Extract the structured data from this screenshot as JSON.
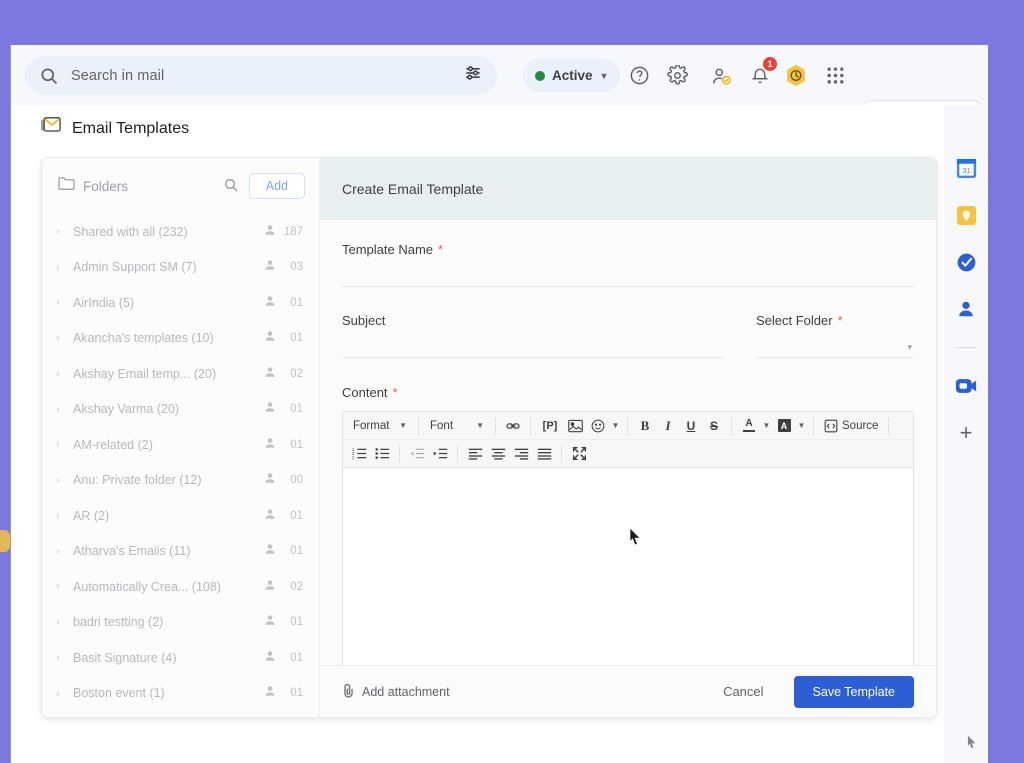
{
  "theme": {
    "purple_bg": "#7b78de",
    "accent_blue": "#2c5fd3",
    "header_bg": "#f6f8fc",
    "form_header_bg": "#e7eff0",
    "hiver_yellow": "#f5c344",
    "required_red": "#e06055",
    "status_green": "#1e8e3e",
    "badge_red": "#ea4335"
  },
  "topbar": {
    "search": {
      "icon": "search-icon",
      "placeholder": "Search in mail",
      "value": "",
      "options_icon": "search-options-icon"
    },
    "status": {
      "label": "Active",
      "dot_color": "#1e8e3e",
      "caret": "⌄"
    },
    "icons": [
      {
        "name": "help-icon",
        "glyph": "?"
      },
      {
        "name": "settings-gear-icon",
        "glyph": "gear"
      },
      {
        "name": "contacts-icon",
        "glyph": "person-check"
      },
      {
        "name": "notifications-bell-icon",
        "glyph": "bell",
        "badge": "1"
      },
      {
        "name": "hiver-clock-icon",
        "glyph": "hexagon-clock"
      },
      {
        "name": "google-apps-icon",
        "glyph": "grid"
      }
    ],
    "brand": {
      "name": "hiver",
      "logo": "hiver-hexagon-logo",
      "avatar": "user-avatar"
    }
  },
  "page": {
    "title": "Email Templates",
    "title_icon": "email-templates-icon"
  },
  "folders": {
    "header_label": "Folders",
    "header_icon": "folder-outline-icon",
    "search_icon": "folders-search-icon",
    "add_label": "Add",
    "items": [
      {
        "name": "Shared with all (232)",
        "users": "187"
      },
      {
        "name": "Admin Support SM (7)",
        "users": "03"
      },
      {
        "name": "AirIndia (5)",
        "users": "01"
      },
      {
        "name": "Akancha's templates (10)",
        "users": "01"
      },
      {
        "name": "Akshay Email temp... (20)",
        "users": "02"
      },
      {
        "name": "Akshay Varma (20)",
        "users": "01"
      },
      {
        "name": "AM-related (2)",
        "users": "01"
      },
      {
        "name": "Anu: Private folder (12)",
        "users": "00"
      },
      {
        "name": "AR (2)",
        "users": "01"
      },
      {
        "name": "Atharva's Emails (11)",
        "users": "01"
      },
      {
        "name": "Automatically Crea... (108)",
        "users": "02"
      },
      {
        "name": "badri testting (2)",
        "users": "01"
      },
      {
        "name": "Basit Signature (4)",
        "users": "01"
      },
      {
        "name": "Boston event (1)",
        "users": "01"
      }
    ]
  },
  "form": {
    "header": "Create Email Template",
    "template_name": {
      "label": "Template Name",
      "required": "*",
      "value": "",
      "placeholder": ""
    },
    "subject": {
      "label": "Subject",
      "required": "",
      "value": "",
      "placeholder": ""
    },
    "select_folder": {
      "label": "Select Folder",
      "required": "*",
      "value": "",
      "caret": "▾"
    },
    "content": {
      "label": "Content",
      "required": "*",
      "value": ""
    },
    "footer": {
      "add_attachment": "Add attachment",
      "attachment_icon": "paperclip-icon",
      "cancel": "Cancel",
      "save": "Save Template"
    }
  },
  "editor_toolbar": {
    "row1": [
      {
        "name": "format-dropdown",
        "label": "Format",
        "type": "combo"
      },
      {
        "name": "font-dropdown",
        "label": "Font",
        "type": "combo"
      },
      {
        "name": "insert-link-icon",
        "label": "",
        "type": "icon"
      },
      {
        "name": "placeholder-icon",
        "label": "[P]",
        "type": "icon"
      },
      {
        "name": "insert-image-icon",
        "label": "",
        "type": "icon"
      },
      {
        "name": "emoji-icon",
        "label": "",
        "type": "icon"
      },
      {
        "name": "bold-icon",
        "label": "B",
        "type": "icon"
      },
      {
        "name": "italic-icon",
        "label": "I",
        "type": "icon"
      },
      {
        "name": "underline-icon",
        "label": "U",
        "type": "icon"
      },
      {
        "name": "strikethrough-icon",
        "label": "S",
        "type": "icon"
      },
      {
        "name": "text-color-icon",
        "label": "A",
        "type": "icon"
      },
      {
        "name": "background-color-icon",
        "label": "A",
        "type": "icon"
      },
      {
        "name": "source-button",
        "label": "Source",
        "type": "text-icon"
      }
    ],
    "row2": [
      {
        "name": "numbered-list-icon"
      },
      {
        "name": "bulleted-list-icon"
      },
      {
        "name": "decrease-indent-icon"
      },
      {
        "name": "increase-indent-icon"
      },
      {
        "name": "align-left-icon"
      },
      {
        "name": "align-center-icon"
      },
      {
        "name": "align-right-icon"
      },
      {
        "name": "align-justify-icon"
      },
      {
        "name": "maximize-icon"
      }
    ]
  },
  "side_rail": {
    "items": [
      {
        "name": "google-calendar-icon",
        "color": "#4285f4"
      },
      {
        "name": "google-keep-icon",
        "color": "#f5c344"
      },
      {
        "name": "google-tasks-icon",
        "color": "#2c5fd3"
      },
      {
        "name": "google-contacts-icon",
        "color": "#2c5fd3"
      },
      {
        "name": "google-meet-icon",
        "color": "#2c5fd3"
      }
    ],
    "add_label": "+"
  }
}
